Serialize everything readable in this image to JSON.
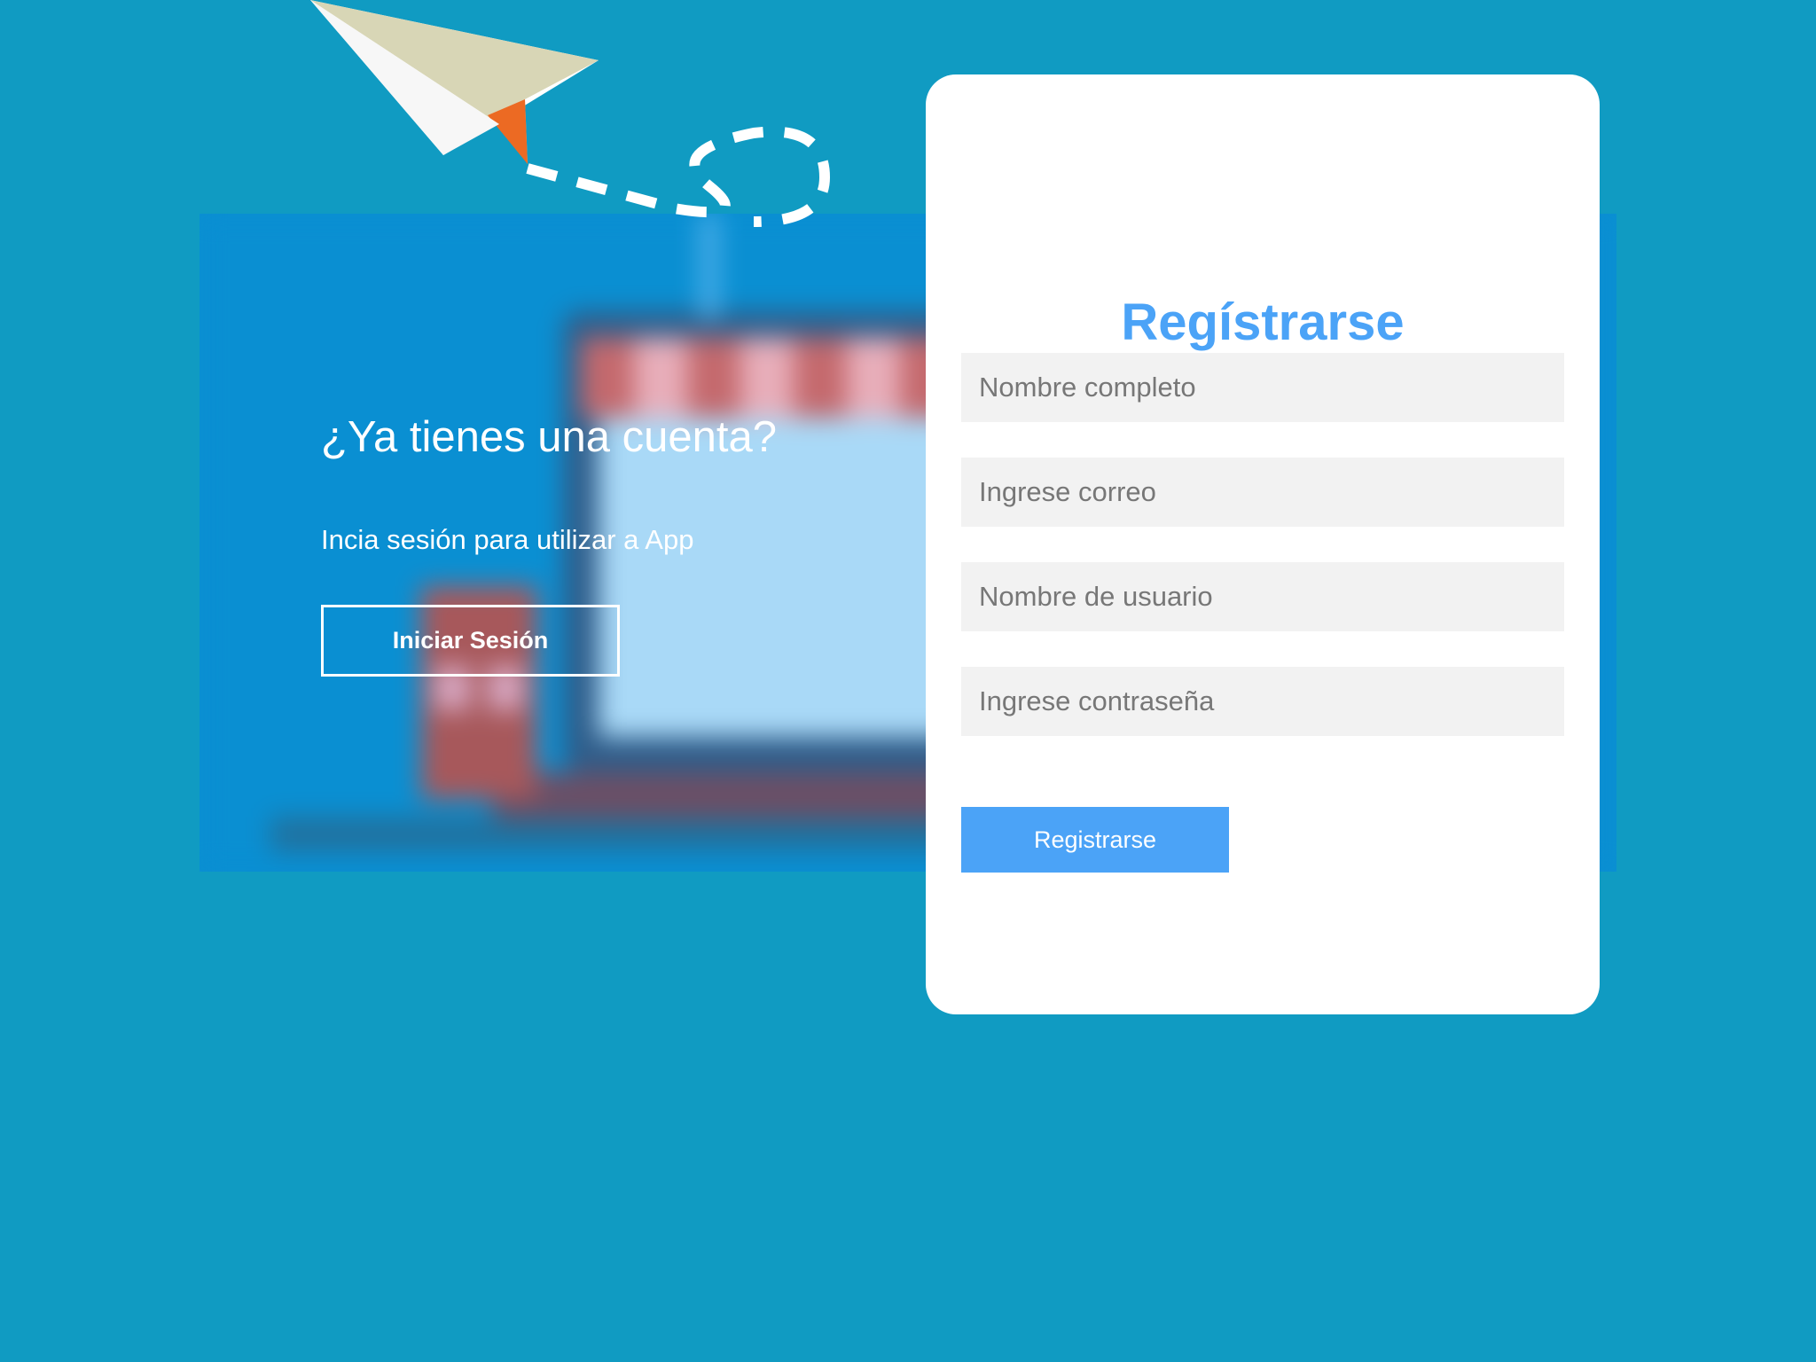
{
  "hero": {
    "title": "¿Ya tienes una cuenta?",
    "subtitle": "Incia sesión para utilizar a App",
    "login_button": "Iniciar Sesión"
  },
  "register": {
    "title": "Regístrarse",
    "fields": [
      {
        "placeholder": "Nombre completo"
      },
      {
        "placeholder": "Ingrese correo"
      },
      {
        "placeholder": "Nombre de usuario"
      },
      {
        "placeholder": "Ingrese contraseña"
      }
    ],
    "submit_button": "Registrarse"
  },
  "colors": {
    "background": "#109bc2",
    "panel": "#0a8fd2",
    "card": "#ffffff",
    "accent": "#4ba3f7",
    "field_bg": "#f2f2f2",
    "placeholder_text": "#777777"
  },
  "icons": {
    "illustration": "paper-plane-icon",
    "background_art": "shop-laptop-illustration"
  }
}
